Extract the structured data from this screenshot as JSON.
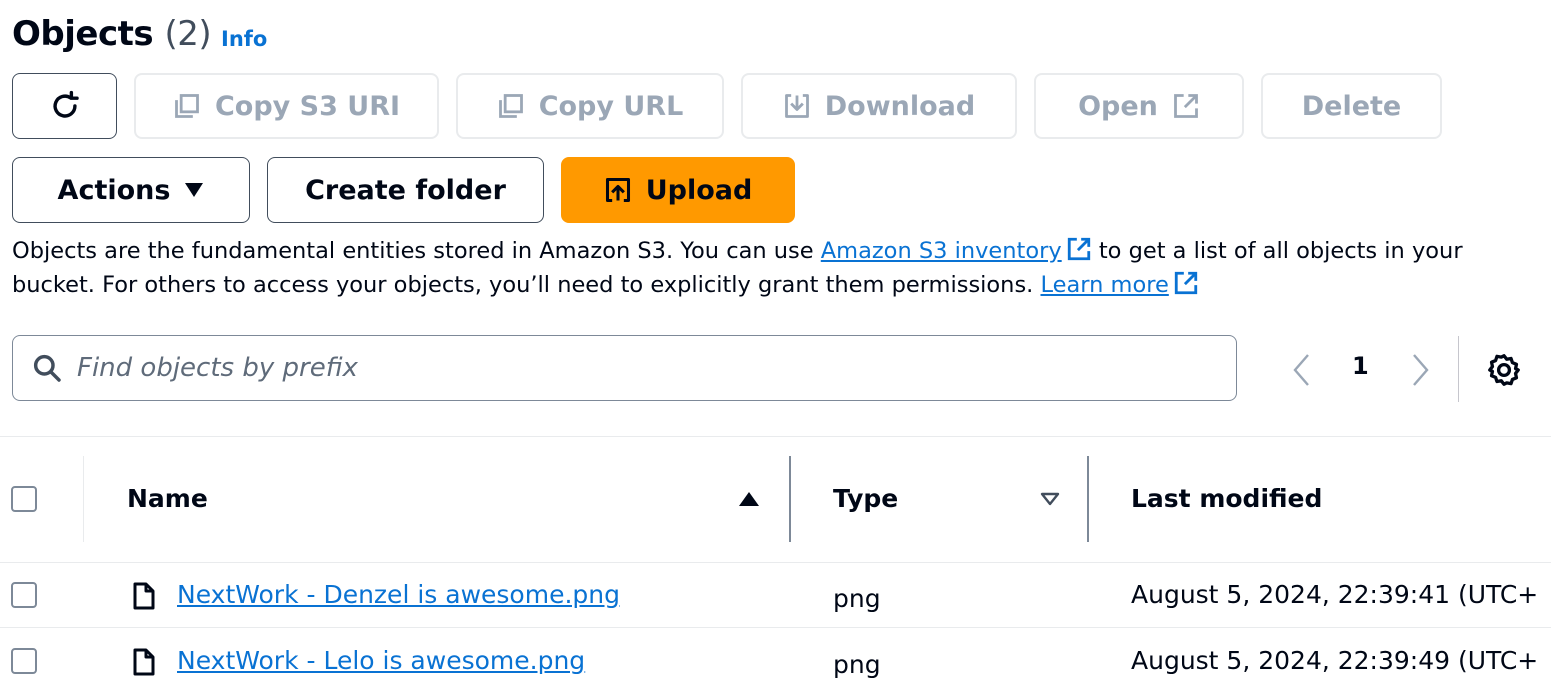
{
  "header": {
    "title": "Objects",
    "count": "(2)",
    "info": "Info"
  },
  "toolbar": {
    "copy_s3_uri": "Copy S3 URI",
    "copy_url": "Copy URL",
    "download": "Download",
    "open": "Open",
    "delete": "Delete",
    "actions": "Actions",
    "create_folder": "Create folder",
    "upload": "Upload"
  },
  "description": {
    "part1": "Objects are the fundamental entities stored in Amazon S3. You can use ",
    "inventory_link": "Amazon S3 inventory",
    "part2": " to get a list of all objects in your bucket. For others to access your objects, you’ll need to explicitly grant them permissions. ",
    "learn_more": "Learn more"
  },
  "search": {
    "placeholder": "Find objects by prefix"
  },
  "pagination": {
    "current_page": "1"
  },
  "table": {
    "columns": [
      "Name",
      "Type",
      "Last modified"
    ],
    "sort": {
      "name": "ascending",
      "type": "unsorted"
    },
    "rows": [
      {
        "name": "NextWork - Denzel is awesome.png",
        "type": "png",
        "last_modified": "August 5, 2024, 22:39:41 (UTC+"
      },
      {
        "name": "NextWork - Lelo is awesome.png",
        "type": "png",
        "last_modified": "August 5, 2024, 22:39:49 (UTC+"
      }
    ]
  },
  "colors": {
    "link": "#0972d3",
    "primary": "#ff9900",
    "disabled_text": "#9ba7b6",
    "text": "#000716"
  },
  "icons": [
    "refresh-icon",
    "copy-icon",
    "download-icon",
    "external-link-icon",
    "caret-down-icon",
    "upload-icon",
    "search-icon",
    "chevron-left-icon",
    "chevron-right-icon",
    "gear-icon",
    "sort-ascending-icon",
    "sort-descending-icon",
    "file-icon"
  ]
}
